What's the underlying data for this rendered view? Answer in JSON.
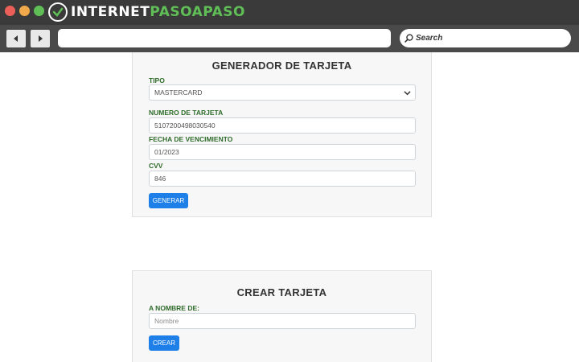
{
  "browser": {
    "logo_part1": "INTERNET",
    "logo_part2": "PASOAPASO",
    "search_label": "Search",
    "address_value": ""
  },
  "generator": {
    "title": "GENERADOR DE TARJETA",
    "tipo_label": "TIPO",
    "tipo_value": "MASTERCARD",
    "numero_label": "NUMERO DE TARJETA",
    "numero_value": "5107200498030540",
    "fecha_label": "FECHA DE VENCIMIENTO",
    "fecha_value": "01/2023",
    "cvv_label": "CVV",
    "cvv_value": "846",
    "generate_button": "GENERAR"
  },
  "create": {
    "title": "CREAR TARJETA",
    "name_label": "A NOMBRE DE:",
    "name_placeholder": "Nombre",
    "create_button": "CREAR"
  },
  "colors": {
    "accent_button": "#1e7fe8",
    "label_green": "#2e6b2a",
    "brand_green": "#5fbf56"
  },
  "icons": [
    "back-arrow-icon",
    "forward-arrow-icon",
    "search-icon",
    "chevron-down-icon",
    "logo-icon"
  ]
}
